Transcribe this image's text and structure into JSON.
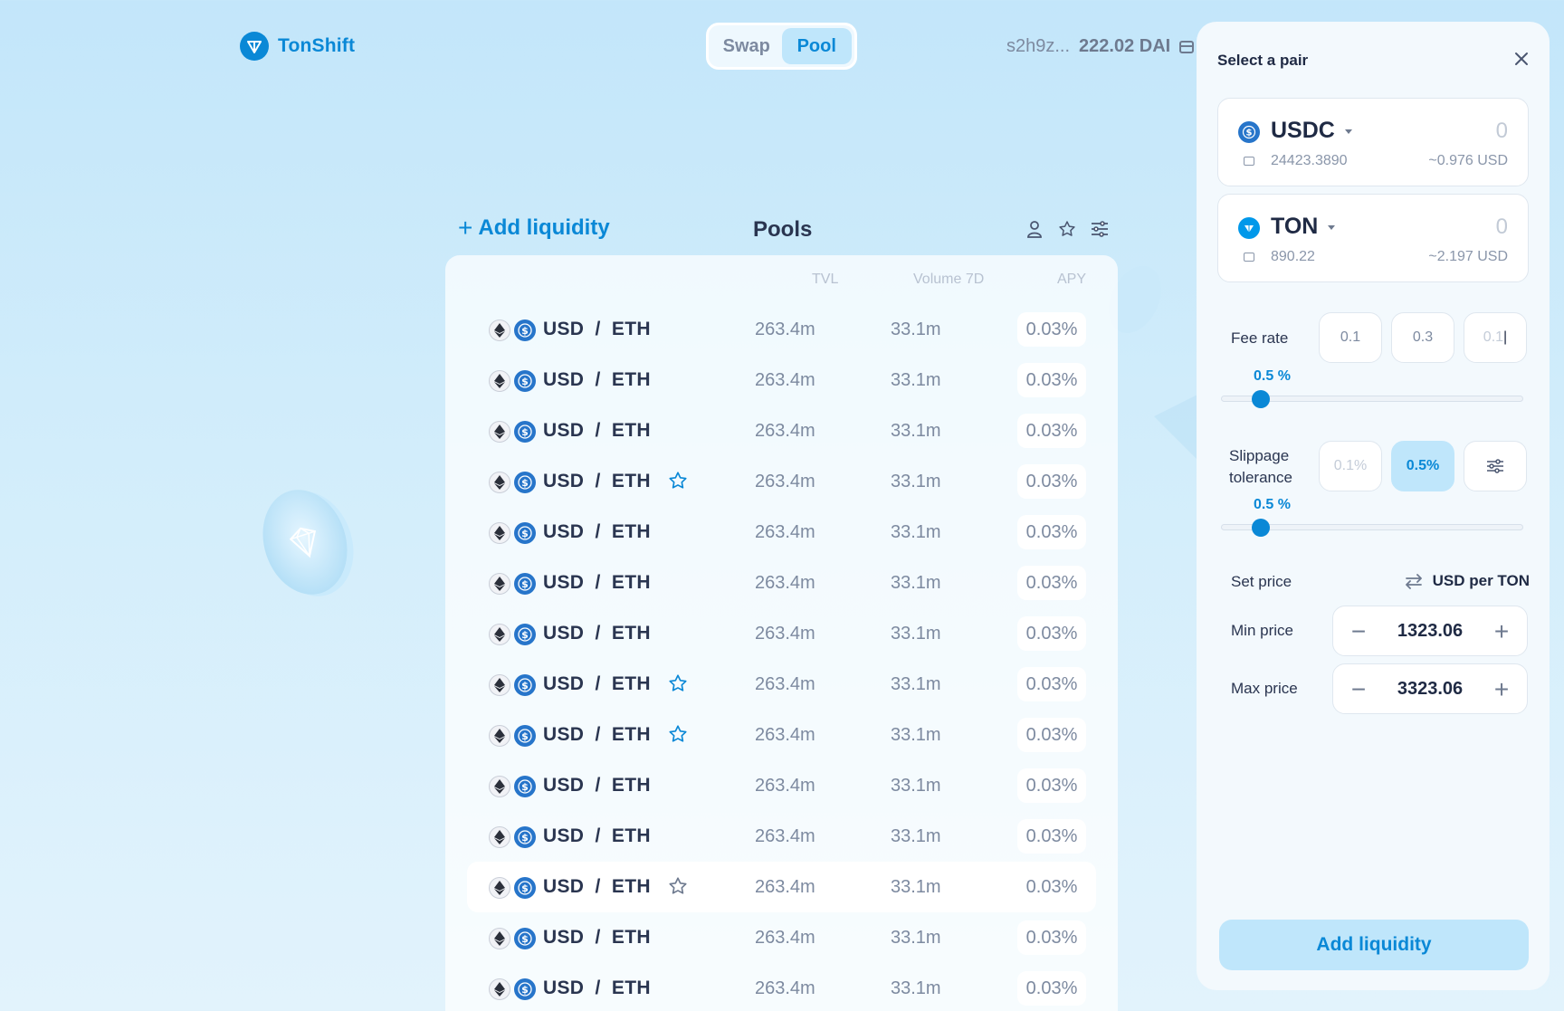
{
  "app": {
    "name": "TonShift"
  },
  "nav": {
    "tabs": [
      {
        "label": "Swap",
        "active": false
      },
      {
        "label": "Pool",
        "active": true
      }
    ]
  },
  "account": {
    "address": "s2h9z...",
    "balance": "222.02 DAI"
  },
  "pools": {
    "add_liquidity_label": "Add liquidity",
    "add_liquidity_plus": "+",
    "title": "Pools",
    "columns": {
      "tvl": "TVL",
      "volume": "Volume 7D",
      "apy": "APY"
    },
    "rows": [
      {
        "pair": "USD  /  ETH",
        "tvl": "263.4m",
        "volume": "33.1m",
        "apy": "0.03%",
        "favorite": false,
        "highlighted": false
      },
      {
        "pair": "USD  /  ETH",
        "tvl": "263.4m",
        "volume": "33.1m",
        "apy": "0.03%",
        "favorite": false,
        "highlighted": false
      },
      {
        "pair": "USD  /  ETH",
        "tvl": "263.4m",
        "volume": "33.1m",
        "apy": "0.03%",
        "favorite": false,
        "highlighted": false
      },
      {
        "pair": "USD  /  ETH",
        "tvl": "263.4m",
        "volume": "33.1m",
        "apy": "0.03%",
        "favorite": true,
        "highlighted": false
      },
      {
        "pair": "USD  /  ETH",
        "tvl": "263.4m",
        "volume": "33.1m",
        "apy": "0.03%",
        "favorite": false,
        "highlighted": false
      },
      {
        "pair": "USD  /  ETH",
        "tvl": "263.4m",
        "volume": "33.1m",
        "apy": "0.03%",
        "favorite": false,
        "highlighted": false
      },
      {
        "pair": "USD  /  ETH",
        "tvl": "263.4m",
        "volume": "33.1m",
        "apy": "0.03%",
        "favorite": false,
        "highlighted": false
      },
      {
        "pair": "USD  /  ETH",
        "tvl": "263.4m",
        "volume": "33.1m",
        "apy": "0.03%",
        "favorite": true,
        "highlighted": false
      },
      {
        "pair": "USD  /  ETH",
        "tvl": "263.4m",
        "volume": "33.1m",
        "apy": "0.03%",
        "favorite": true,
        "highlighted": false
      },
      {
        "pair": "USD  /  ETH",
        "tvl": "263.4m",
        "volume": "33.1m",
        "apy": "0.03%",
        "favorite": false,
        "highlighted": false
      },
      {
        "pair": "USD  /  ETH",
        "tvl": "263.4m",
        "volume": "33.1m",
        "apy": "0.03%",
        "favorite": false,
        "highlighted": false
      },
      {
        "pair": "USD  /  ETH",
        "tvl": "263.4m",
        "volume": "33.1m",
        "apy": "0.03%",
        "favorite": false,
        "highlighted": true
      },
      {
        "pair": "USD  /  ETH",
        "tvl": "263.4m",
        "volume": "33.1m",
        "apy": "0.03%",
        "favorite": false,
        "highlighted": false
      },
      {
        "pair": "USD  /  ETH",
        "tvl": "263.4m",
        "volume": "33.1m",
        "apy": "0.03%",
        "favorite": false,
        "highlighted": false
      }
    ]
  },
  "panel": {
    "title": "Select a pair",
    "token_a": {
      "symbol": "USDC",
      "amount": "0",
      "balance": "24423.3890",
      "usd": "~0.976 USD",
      "icon": "usdc-icon"
    },
    "token_b": {
      "symbol": "TON",
      "amount": "0",
      "balance": "890.22",
      "usd": "~2.197 USD",
      "icon": "ton-icon"
    },
    "fee_rate": {
      "label": "Fee rate",
      "options": [
        "0.1",
        "0.3"
      ],
      "custom_placeholder": "0.1",
      "value_label": "0.5 %",
      "value_fraction": 0.13
    },
    "slippage": {
      "label_line1": "Slippage",
      "label_line2": "tolerance",
      "options": [
        "0.1%",
        "0.5%"
      ],
      "active_index": 1,
      "value_label": "0.5 %",
      "value_fraction": 0.13
    },
    "set_price": {
      "label": "Set price",
      "unit": "USD per TON"
    },
    "min_price": {
      "label": "Min price",
      "value": "1323.06"
    },
    "max_price": {
      "label": "Max price",
      "value": "3323.06"
    },
    "submit_label": "Add liquidity"
  },
  "colors": {
    "accent": "#0a88d6",
    "accent_soft": "#bfe6fb",
    "usdc": "#2775ca",
    "ton": "#0098ea",
    "text": "#1f2a44",
    "muted": "#7d8aa0"
  }
}
